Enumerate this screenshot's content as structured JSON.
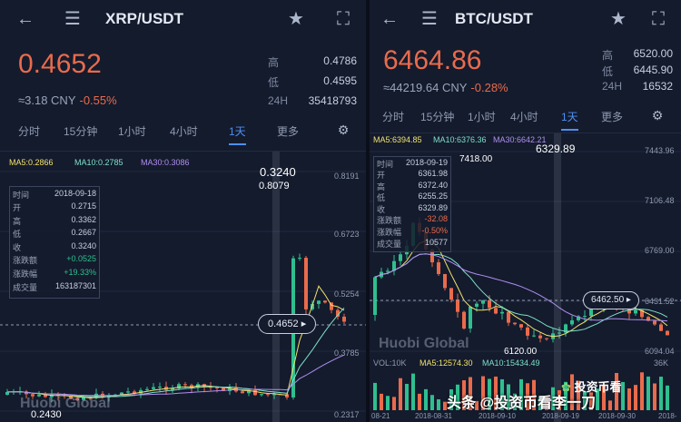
{
  "left": {
    "pair": "XRP/USDT",
    "price": "0.4652",
    "cny": "≈3.18 CNY",
    "change": "-0.55%",
    "stats": [
      {
        "label": "高",
        "value": "0.4786"
      },
      {
        "label": "低",
        "value": "0.4595"
      },
      {
        "label": "24H",
        "value": "35418793"
      }
    ],
    "tabs": [
      "分时",
      "15分钟",
      "1小时",
      "4小时",
      "1天",
      "更多"
    ],
    "ma5": "MA5:0.2866",
    "ma10": "MA10:0.2785",
    "ma30": "MA30:0.3086",
    "info": [
      {
        "label": "时间",
        "value": "2018-09-18"
      },
      {
        "label": "开",
        "value": "0.2715"
      },
      {
        "label": "高",
        "value": "0.3362"
      },
      {
        "label": "低",
        "value": "0.2667"
      },
      {
        "label": "收",
        "value": "0.3240"
      },
      {
        "label": "涨跌额",
        "value": "+0.0525"
      },
      {
        "label": "涨跌幅",
        "value": "+19.33%"
      },
      {
        "label": "成交量",
        "value": "163187301"
      }
    ],
    "yaxis": [
      "0.8191",
      "0.6723",
      "0.5254",
      "0.3785",
      "0.2317"
    ],
    "peak_label": "0.3240",
    "peak_high": "0.8079",
    "low_label": "0.2430",
    "bubble": "0.4652",
    "watermark": "Huobi Global"
  },
  "right": {
    "pair": "BTC/USDT",
    "price": "6464.86",
    "cny": "≈44219.64 CNY",
    "change": "-0.28%",
    "stats": [
      {
        "label": "高",
        "value": "6520.00"
      },
      {
        "label": "低",
        "value": "6445.90"
      },
      {
        "label": "24H",
        "value": "16532"
      }
    ],
    "tabs": [
      "分时",
      "15分钟",
      "1小时",
      "4小时",
      "1天",
      "更多"
    ],
    "ma5": "MA5:6394.85",
    "ma10": "MA10:6376.36",
    "ma30": "MA30:6642.21",
    "info": [
      {
        "label": "时间",
        "value": "2018-09-19"
      },
      {
        "label": "开",
        "value": "6361.98"
      },
      {
        "label": "高",
        "value": "6372.40"
      },
      {
        "label": "低",
        "value": "6255.25"
      },
      {
        "label": "收",
        "value": "6329.89"
      },
      {
        "label": "涨跌额",
        "value": "-32.08"
      },
      {
        "label": "涨跌幅",
        "value": "-0.50%"
      },
      {
        "label": "成交量",
        "value": "10577"
      }
    ],
    "yaxis": [
      "7443.96",
      "7106.48",
      "6769.00",
      "6431.52",
      "6094.04"
    ],
    "peak_label": "7418.00",
    "close_label": "6329.89",
    "low_label": "6120.00",
    "bubble": "6462.50",
    "watermark": "Huobi Global",
    "vol": "VOL:10K",
    "vol_ma5": "MA5:12574.30",
    "vol_ma10": "MA10:15434.49",
    "vol_max": "36K",
    "dates": [
      "08-21",
      "2018-08-31",
      "2018-09-10",
      "2018-09-19",
      "2018-09-30",
      "2018-"
    ]
  },
  "caption": "头条 @投资币看李一刀",
  "wechat": "投资币看",
  "colors": {
    "up": "#2fbf8f",
    "down": "#e96b4c",
    "ma5": "#f2e36b",
    "ma10": "#7ee0c9",
    "ma30": "#b08ef0",
    "accent": "#4e8ff0"
  }
}
